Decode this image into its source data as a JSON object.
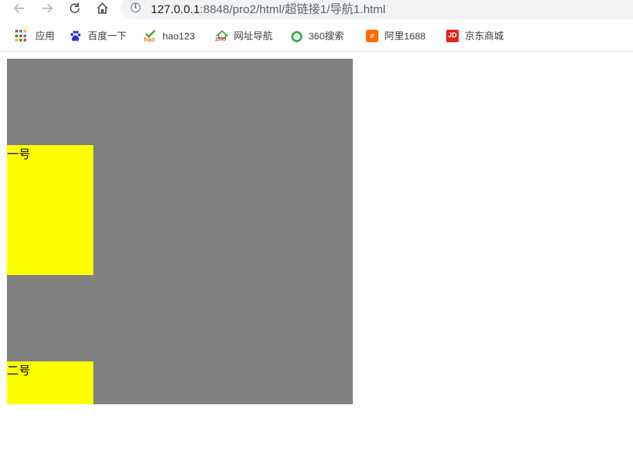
{
  "browser": {
    "url_host": "127.0.0.1",
    "url_rest": ":8848/pro2/html/超链接1/导航1.html",
    "bookmarks": [
      {
        "label": "应用",
        "icon": "apps-icon"
      },
      {
        "label": "百度一下",
        "icon": "baidu-icon"
      },
      {
        "label": "hao123",
        "icon": "hao123-icon"
      },
      {
        "label": "网址导航",
        "icon": "2345-icon"
      },
      {
        "label": "360搜索",
        "icon": "360-search-icon"
      },
      {
        "label": "阿里1688",
        "icon": "alibaba-1688-icon"
      },
      {
        "label": "京东商城",
        "icon": "jd-icon"
      }
    ],
    "icon_text": {
      "hao": "hao",
      "digits": "2345",
      "ali": "e",
      "jd": "JD"
    }
  },
  "page": {
    "box_colors": {
      "outer": "#808080",
      "block": "#ffff00"
    },
    "blocks": [
      {
        "label": "一号"
      },
      {
        "label": "二号"
      }
    ]
  }
}
